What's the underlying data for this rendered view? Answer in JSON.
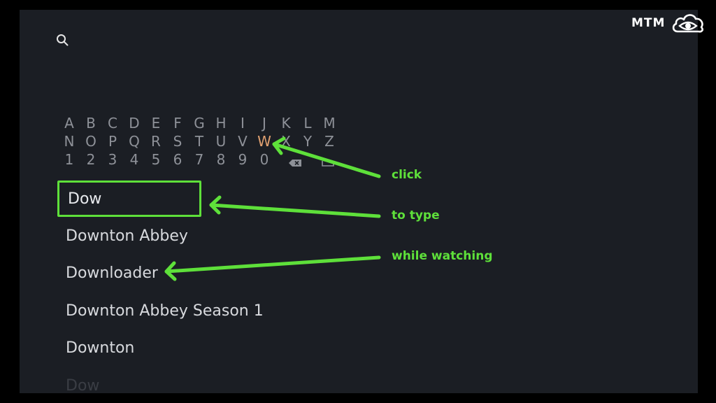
{
  "brand": {
    "text": "MTM",
    "icon": "cloud-eye-icon"
  },
  "search": {
    "icon": "search-icon"
  },
  "keyboard": {
    "row1": [
      "A",
      "B",
      "C",
      "D",
      "E",
      "F",
      "G",
      "H",
      "I",
      "J",
      "K",
      "L",
      "M"
    ],
    "row2": [
      "N",
      "O",
      "P",
      "Q",
      "R",
      "S",
      "T",
      "U",
      "V",
      "W",
      "X",
      "Y",
      "Z"
    ],
    "row3": [
      "1",
      "2",
      "3",
      "4",
      "5",
      "6",
      "7",
      "8",
      "9",
      "0"
    ],
    "active_key": "W",
    "backspace_icon": "backspace-icon",
    "space_icon": "space-icon",
    "active_color": "#e0a070"
  },
  "results": [
    {
      "label": "Dow"
    },
    {
      "label": "Downton Abbey"
    },
    {
      "label": "Downloader"
    },
    {
      "label": "Downton Abbey Season 1"
    },
    {
      "label": "Downton"
    },
    {
      "label": "Dow"
    }
  ],
  "annotations": {
    "click": "click",
    "to_type": "to type",
    "while_watching": "while watching",
    "color": "#5ee03a"
  }
}
